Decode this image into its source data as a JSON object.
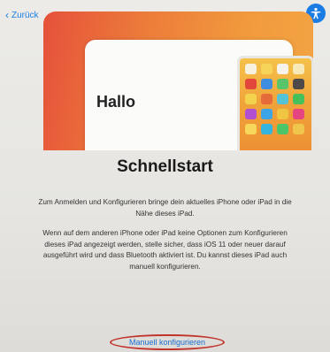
{
  "nav": {
    "back_label": "Zurück"
  },
  "hero": {
    "greeting": "Hallo"
  },
  "main": {
    "title": "Schnellstart",
    "paragraph1": "Zum Anmelden und Konfigurieren bringe dein aktuelles iPhone oder iPad in die Nähe dieses iPad.",
    "paragraph2": "Wenn auf dem anderen iPhone oder iPad keine Optionen zum Konfigurieren dieses iPad angezeigt werden, stelle sicher, dass iOS 11 oder neuer darauf ausgeführt wird und dass Bluetooth aktiviert ist. Du kannst dieses iPad auch manuell konfigurieren.",
    "manual_button": "Manuell konfigurieren"
  },
  "colors": {
    "accent": "#1b7de3",
    "highlight": "#c0342c"
  },
  "icons": {
    "back": "chevron-left-icon",
    "accessibility": "accessibility-icon"
  }
}
